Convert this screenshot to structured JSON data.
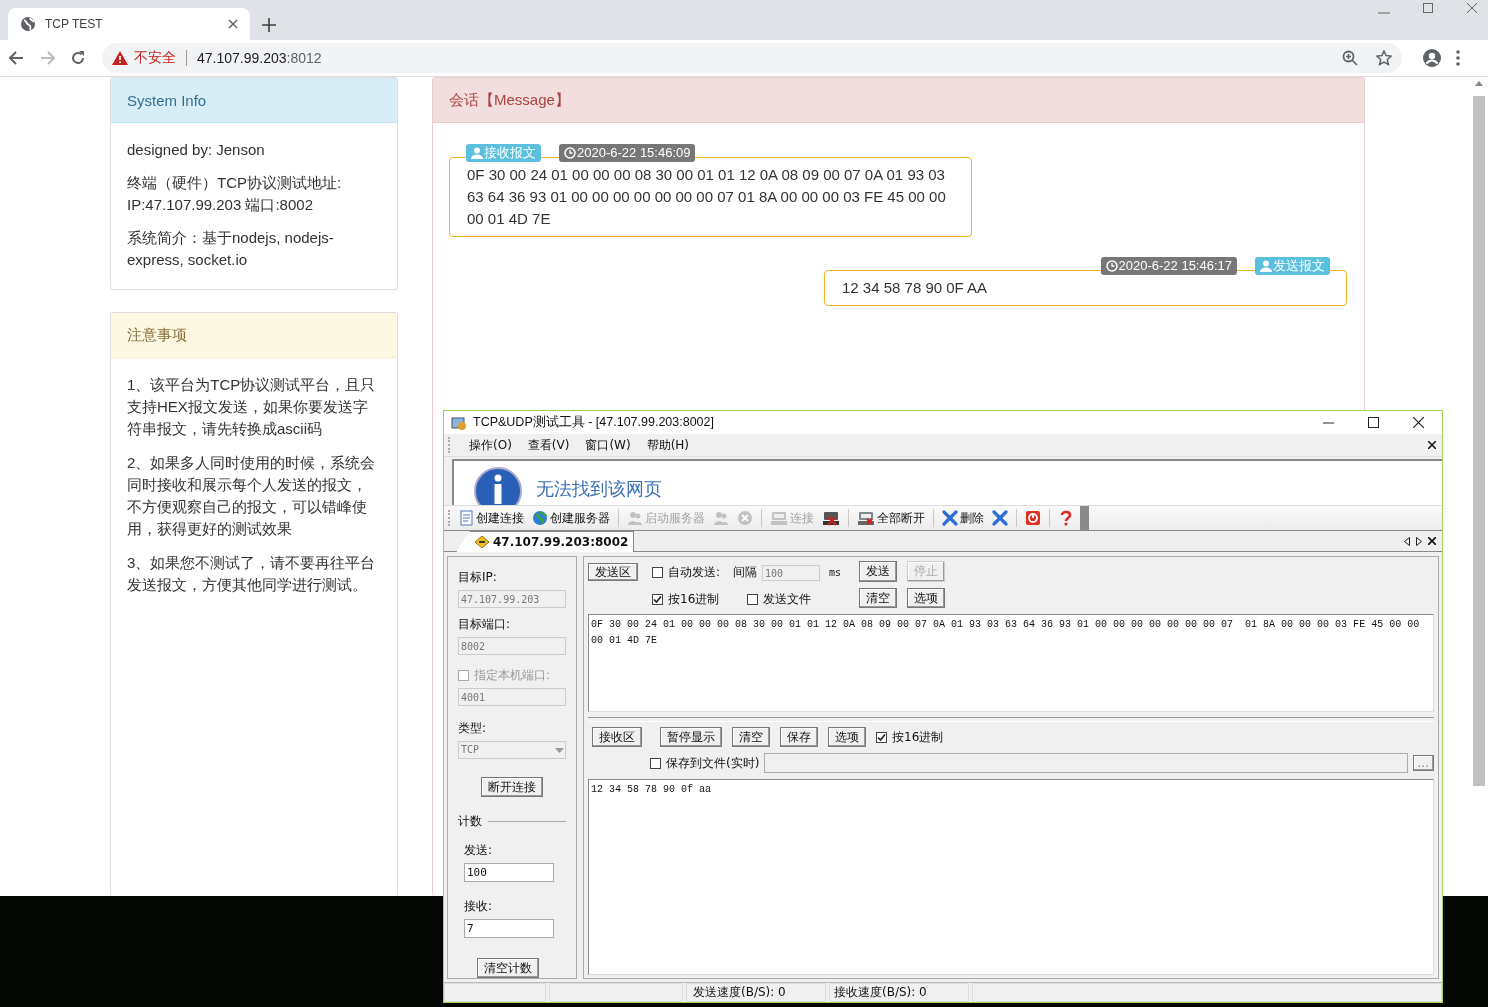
{
  "browser": {
    "tab_title": "TCP TEST",
    "security_label": "不安全",
    "url_host": "47.107.99.203",
    "url_port": ":8012"
  },
  "system_info": {
    "title": "System Info",
    "lines": [
      "designed by: Jenson",
      "终端（硬件）TCP协议测试地址: IP:47.107.99.203 端口:8002",
      "系统简介：基于nodejs, nodejs-express, socket.io"
    ]
  },
  "notes": {
    "title": "注意事项",
    "items": [
      "1、该平台为TCP协议测试平台，且只支持HEX报文发送，如果你要发送字符串报文，请先转换成ascii码",
      "2、如果多人同时使用的时候，系统会同时接收和展示每个人发送的报文，不方便观察自己的报文，可以错峰使用，获得更好的测试效果",
      "3、如果您不测试了，请不要再往平台发送报文，方便其他同学进行测试。"
    ]
  },
  "session": {
    "title": "会话【Message】",
    "messages": [
      {
        "kind": "received",
        "label": "接收报文",
        "time": "2020-6-22 15:46:09",
        "content": "0F 30 00 24 01 00 00 00 08 30 00 01 01 12 0A 08 09 00 07 0A 01 93 03 63 64 36 93 01 00 00 00 00 00 00 00 07 01 8A 00 00 00 03 FE 45 00 00 00 01 4D 7E"
      },
      {
        "kind": "sent",
        "label": "发送报文",
        "time": "2020-6-22 15:46:17",
        "content": "12 34 58 78 90 0F AA"
      }
    ]
  },
  "tool": {
    "title": "TCP&UDP测试工具 - [47.107.99.203:8002]",
    "menu": [
      "操作(O)",
      "查看(V)",
      "窗口(W)",
      "帮助(H)"
    ],
    "web_message": "无法找到该网页",
    "toolbar": [
      {
        "kind": "button",
        "label": "创建连接",
        "disabled": false
      },
      {
        "kind": "button",
        "label": "创建服务器",
        "disabled": false
      },
      {
        "kind": "separator"
      },
      {
        "kind": "button",
        "label": "启动服务器",
        "disabled": true
      },
      {
        "kind": "icon",
        "disabled": true
      },
      {
        "kind": "icon",
        "disabled": true
      },
      {
        "kind": "separator"
      },
      {
        "kind": "button",
        "label": "连接",
        "disabled": true
      },
      {
        "kind": "icon",
        "disabled": false
      },
      {
        "kind": "separator"
      },
      {
        "kind": "button",
        "label": "全部断开",
        "disabled": false
      },
      {
        "kind": "separator"
      },
      {
        "kind": "button",
        "label": "删除",
        "disabled": false
      },
      {
        "kind": "icon",
        "disabled": false
      },
      {
        "kind": "separator"
      },
      {
        "kind": "icon",
        "disabled": false
      },
      {
        "kind": "separator"
      },
      {
        "kind": "icon",
        "disabled": false
      }
    ],
    "tabs": [
      {
        "label": "47.107.99.203:8002",
        "selected": true
      }
    ],
    "target_ip": {
      "label": "目标IP:",
      "value": "47.107.99.203",
      "disabled": true
    },
    "target_port": {
      "label": "目标端口:",
      "value": "8002",
      "disabled": true
    },
    "local_port": {
      "label": "指定本机端口:",
      "checked": false,
      "disabled": true,
      "value": "4001"
    },
    "type": {
      "label": "类型:",
      "value": "TCP",
      "disabled": true
    },
    "disconnect_button": "断开连接",
    "count": {
      "title": "计数",
      "sent_label": "发送:",
      "sent_value": "100",
      "received_label": "接收:",
      "received_value": "7",
      "clear_button": "清空计数"
    },
    "send": {
      "area_button": "发送区",
      "auto_send": {
        "label": "自动发送:",
        "checked": false
      },
      "interval_label": "间隔",
      "interval_value": "100",
      "interval_unit": "ms",
      "send_button": "发送",
      "stop_button": {
        "label": "停止",
        "disabled": true
      },
      "hex": {
        "label": "按16进制",
        "checked": true
      },
      "send_file": {
        "label": "发送文件",
        "checked": false
      },
      "clear_button": "清空",
      "options_button": "选项",
      "lines": [
        "0F 30 00 24 01 00 00 00 08 30 00 01 01 12 0A 08 09 00 07 0A 01 93 03 63 64 36 93 01 00 00 00 00 00 00 00 07  01 8A 00 00 00 03 FE 45 00 00",
        "00 01 4D 7E"
      ]
    },
    "receive": {
      "area_button": "接收区",
      "pause_button": "暂停显示",
      "clear_button": "清空",
      "save_button": "保存",
      "options_button": "选项",
      "hex": {
        "label": "按16进制",
        "checked": true
      },
      "save_to_file": {
        "label": "保存到文件(实时)",
        "checked": false
      },
      "browse_button": "...",
      "lines": [
        "12 34 58 78 90 0f aa"
      ]
    },
    "status": [
      "发送速度(B/S): 0",
      "接收速度(B/S): 0"
    ]
  }
}
